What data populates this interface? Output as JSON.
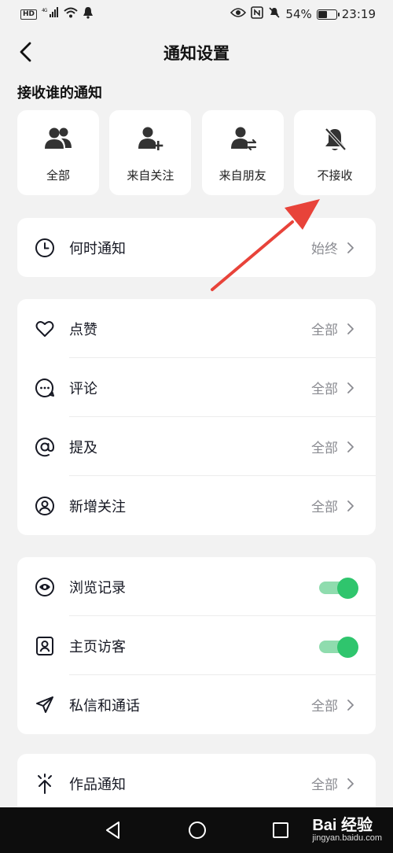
{
  "status_bar": {
    "hd": "HD",
    "signal": "4G",
    "battery_text": "54%",
    "battery_level": 0.54,
    "time": "23:19"
  },
  "header": {
    "title": "通知设置"
  },
  "receive_section": {
    "label": "接收谁的通知",
    "options": [
      {
        "label": "全部",
        "icon": "users-icon"
      },
      {
        "label": "来自关注",
        "icon": "user-add-icon"
      },
      {
        "label": "来自朋友",
        "icon": "user-friends-icon"
      },
      {
        "label": "不接收",
        "icon": "bell-off-icon"
      }
    ]
  },
  "when": {
    "label": "何时通知",
    "value": "始终"
  },
  "interactions": [
    {
      "label": "点赞",
      "value": "全部",
      "icon": "heart-icon"
    },
    {
      "label": "评论",
      "value": "全部",
      "icon": "comment-icon"
    },
    {
      "label": "提及",
      "value": "全部",
      "icon": "at-icon"
    },
    {
      "label": "新增关注",
      "value": "全部",
      "icon": "user-circle-icon"
    }
  ],
  "privacy": {
    "browse_history": {
      "label": "浏览记录",
      "enabled": true
    },
    "profile_visitors": {
      "label": "主页访客",
      "enabled": true
    },
    "messages": {
      "label": "私信和通话",
      "value": "全部"
    }
  },
  "works": {
    "label": "作品通知",
    "value": "全部"
  },
  "colors": {
    "accent": "#2fc56d",
    "arrow": "#e8433a"
  },
  "watermark": {
    "brand": "Bai 经验",
    "site": "jingyan.baidu.com"
  }
}
